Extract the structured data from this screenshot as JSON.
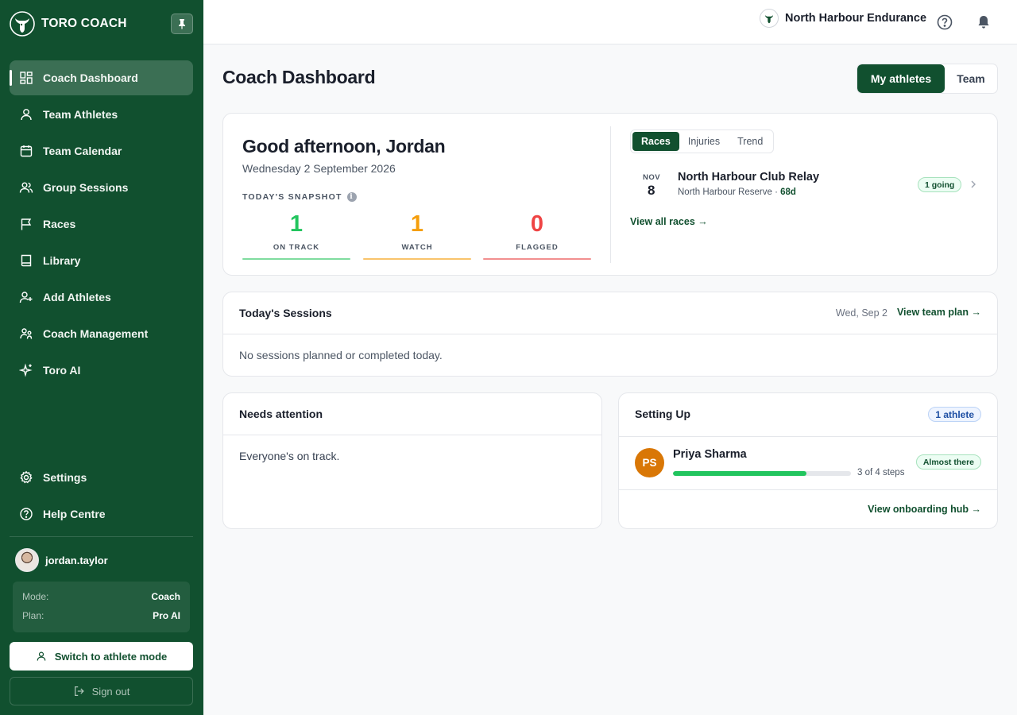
{
  "app": {
    "brand": "TORO COACH",
    "org_name": "North Harbour Endurance"
  },
  "sidebar": {
    "items": [
      {
        "label": "Coach Dashboard",
        "icon": "dashboard-grid-icon",
        "active": true
      },
      {
        "label": "Team Athletes",
        "icon": "user-icon"
      },
      {
        "label": "Team Calendar",
        "icon": "calendar-icon"
      },
      {
        "label": "Group Sessions",
        "icon": "users-icon"
      },
      {
        "label": "Races",
        "icon": "flag-icon"
      },
      {
        "label": "Library",
        "icon": "book-icon"
      },
      {
        "label": "Add Athletes",
        "icon": "user-plus-icon"
      },
      {
        "label": "Coach Management",
        "icon": "coach-users-icon"
      },
      {
        "label": "Toro AI",
        "icon": "sparkle-icon"
      }
    ],
    "bottom_items": [
      {
        "label": "Settings",
        "icon": "gear-icon"
      },
      {
        "label": "Help Centre",
        "icon": "help-circle-icon"
      }
    ],
    "user": {
      "name": "jordan.taylor"
    },
    "plan": {
      "mode_label": "Mode:",
      "mode_value": "Coach",
      "plan_label": "Plan:",
      "plan_value": "Pro AI"
    },
    "switch_label": "Switch to athlete mode",
    "signout_label": "Sign out"
  },
  "header": {
    "page_title": "Coach Dashboard",
    "toggle": {
      "mine": "My athletes",
      "team": "Team"
    }
  },
  "hero": {
    "greeting": "Good afternoon, Jordan",
    "date": "Wednesday 2 September 2026",
    "snapshot_label": "TODAY'S SNAPSHOT",
    "info_icon_glyph": "i",
    "stats": [
      {
        "value": "1",
        "label": "ON TRACK",
        "color": "#22c55e"
      },
      {
        "value": "1",
        "label": "WATCH",
        "color": "#f59e0b"
      },
      {
        "value": "0",
        "label": "FLAGGED",
        "color": "#ef4444"
      }
    ],
    "tabs": [
      "Races",
      "Injuries",
      "Trend"
    ],
    "race": {
      "month": "NOV",
      "day": "8",
      "name": "North Harbour Club Relay",
      "venue": "North Harbour Reserve · ",
      "days_out": "68d",
      "badge": "1 going"
    },
    "view_all": "View all races →"
  },
  "sessions": {
    "title": "Today's Sessions",
    "date": "Wed, Sep 2",
    "link": "View team plan →",
    "empty": "No sessions planned or completed today."
  },
  "attention": {
    "title": "Needs attention",
    "empty": "Everyone's on track."
  },
  "setup": {
    "title": "Setting Up",
    "count_badge": "1 athlete",
    "athlete": {
      "initials": "PS",
      "name": "Priya Sharma",
      "progress": 0.75,
      "steps": "3 of 4 steps",
      "status": "Almost there"
    },
    "link": "View onboarding hub →"
  },
  "colors": {
    "brand": "#11502f",
    "accent_green": "#22c55e",
    "watch": "#f59e0b",
    "flagged": "#ef4444"
  }
}
